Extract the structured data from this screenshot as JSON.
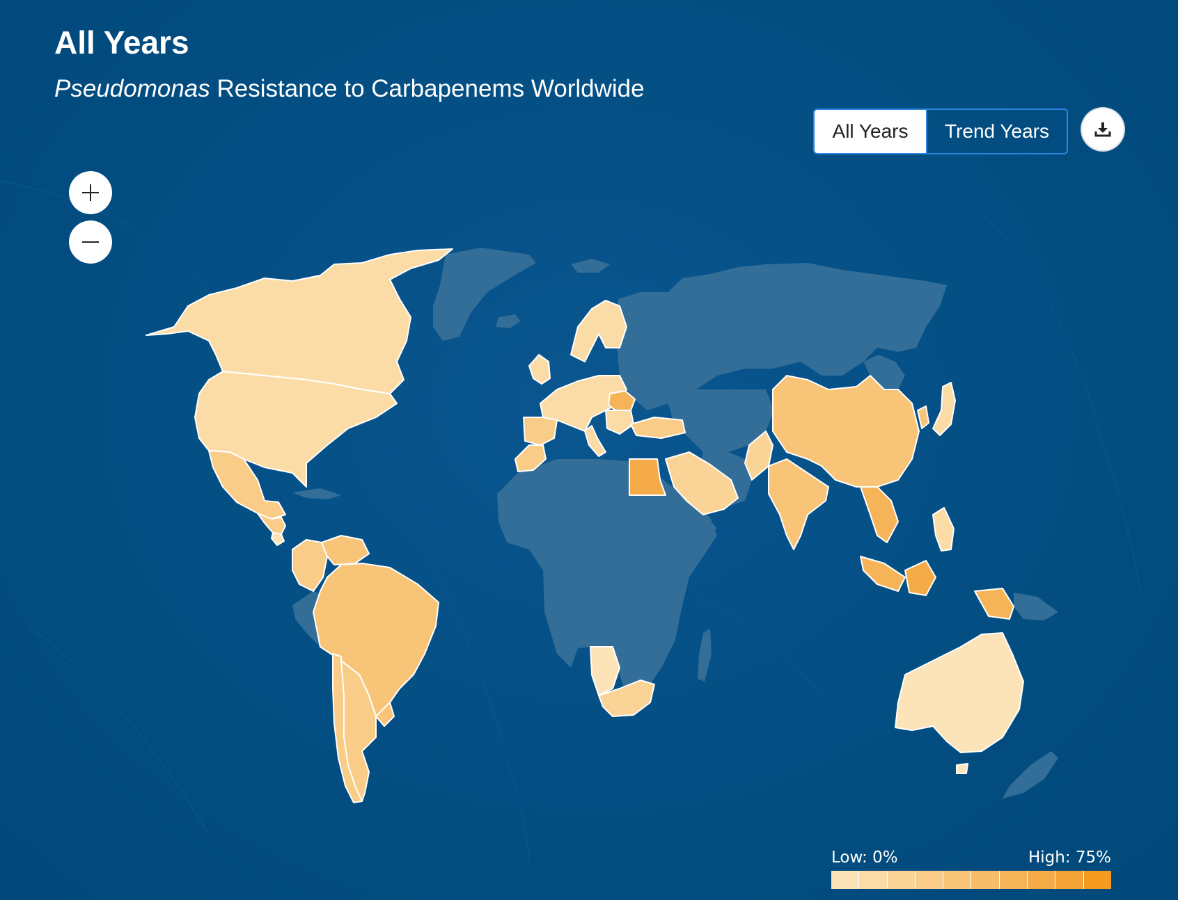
{
  "header": {
    "title": "All Years",
    "subtitle_organism": "Pseudomonas",
    "subtitle_rest": " Resistance to Carbapenems Worldwide"
  },
  "toolbar": {
    "all_years_label": "All Years",
    "trend_years_label": "Trend Years",
    "active_tab": "All Years",
    "download_icon": "download-icon"
  },
  "zoom": {
    "zoom_in_icon": "plus-icon",
    "zoom_out_icon": "minus-icon"
  },
  "legend": {
    "low_label": "Low: 0%",
    "high_label": "High: 75%",
    "colors": [
      "#fce4b8",
      "#fbdca7",
      "#fad497",
      "#f9cc87",
      "#f8c478",
      "#f7bc68",
      "#f6b458",
      "#f5ab47",
      "#f4a337",
      "#f39a1f"
    ]
  },
  "colors": {
    "ocean": "#034e82",
    "no_data": "#336e98",
    "border": "#ffffff",
    "toggle_border": "#2b86e0"
  }
}
